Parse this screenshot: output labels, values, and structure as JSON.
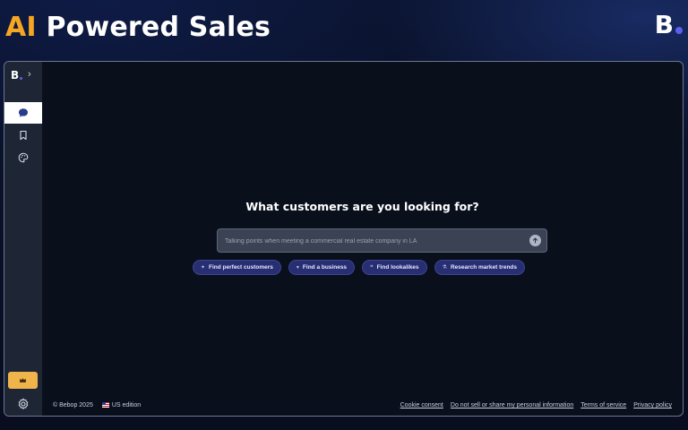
{
  "hero": {
    "title_accent": "AI",
    "title_rest": "Powered Sales",
    "brand_letter": "B"
  },
  "sidebar": {
    "logo_letter": "B",
    "expand_icon": "chevron-right-icon",
    "items": [
      {
        "name": "chat",
        "icon": "chat-bubble-icon",
        "active": true
      },
      {
        "name": "saved",
        "icon": "bookmark-icon",
        "active": false
      },
      {
        "name": "theme",
        "icon": "palette-icon",
        "active": false
      }
    ],
    "upgrade_icon": "crown-icon",
    "settings_icon": "gear-icon"
  },
  "main": {
    "question": "What customers are you looking for?",
    "search": {
      "placeholder": "Talking points when meeting a commercial real estate company in LA",
      "value": ""
    },
    "chips": [
      {
        "label": "Find perfect customers",
        "icon": "sparkle-icon"
      },
      {
        "label": "Find a business",
        "icon": "funnel-icon"
      },
      {
        "label": "Find lookalikes",
        "icon": "quote-icon"
      },
      {
        "label": "Research market trends",
        "icon": "flask-icon"
      }
    ]
  },
  "footer": {
    "copyright": "© Bebop 2025",
    "edition": "US edition",
    "links": [
      "Cookie consent",
      "Do not sell or share my personal information",
      "Terms of service",
      "Privacy policy"
    ]
  },
  "colors": {
    "accent_orange": "#f5a623",
    "brand_dot": "#5b5ff0",
    "chip_bg": "#272f72",
    "upgrade_bg": "#f0b54a"
  }
}
